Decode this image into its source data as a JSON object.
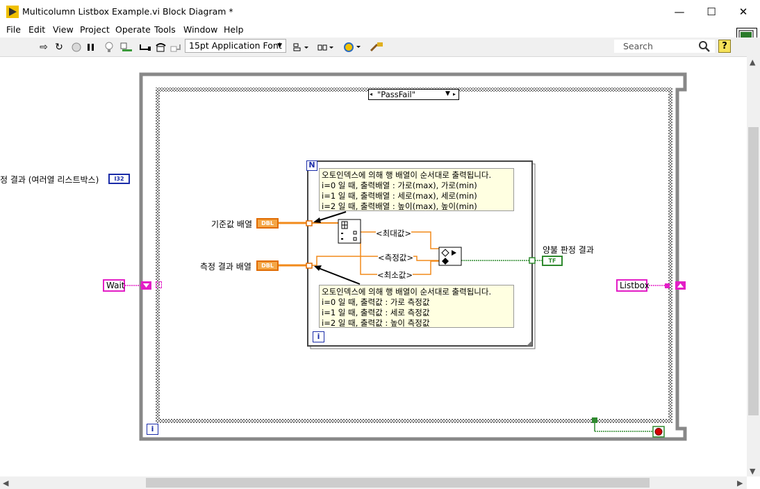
{
  "window": {
    "title": "Multicolumn Listbox Example.vi Block Diagram *",
    "minimize_glyph": "—",
    "maximize_glyph": "☐",
    "close_glyph": "✕"
  },
  "menu": [
    "File",
    "Edit",
    "View",
    "Project",
    "Operate",
    "Tools",
    "Window",
    "Help"
  ],
  "toolbar": {
    "font_label": "15pt Application Font",
    "search_placeholder": "Search",
    "help_glyph": "?"
  },
  "diagram": {
    "case_selector": "\"PassFail\"",
    "for_loop_n": "N",
    "for_loop_i": "i",
    "while_loop_i": "i",
    "left_indicator_label": "정 결과 (여러열 리스트박스)",
    "left_indicator_type": "I32",
    "wait_label": "Wait",
    "listbox_label": "Listbox",
    "input1_label": "기준값 배열",
    "input2_label": "측정 결과 배열",
    "dbl_tag": "DBL",
    "tf_tag": "TF",
    "output_label": "양불 판정 결과",
    "max_label": "<최대값>",
    "measure_label": "<측정값>",
    "min_label": "<최소값>",
    "comment_top": [
      "오토인덱스에 의해 행 배열이 순서대로 출력됩니다.",
      "i=0 일 때, 출력배열 : 가로(max), 가로(min)",
      "i=1 일 때, 출력배열 : 세로(max), 세로(min)",
      "i=2 일 때, 출력배열 : 높이(max), 높이(min)"
    ],
    "comment_bottom": [
      "오토인덱스에 의해 행 배열이 순서대로 출력됩니다.",
      "i=0 일 때, 출력값 : 가로 측정값",
      "i=1 일 때, 출력값 : 세로 측정값",
      "i=2 일 때, 출력값 : 높이 측정값"
    ]
  }
}
